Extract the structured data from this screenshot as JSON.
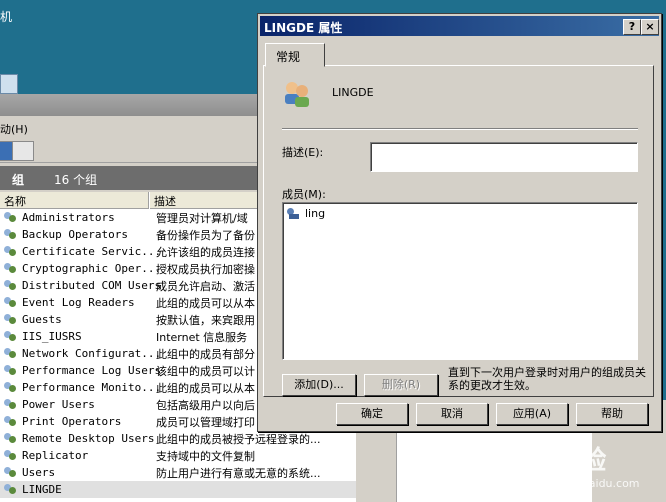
{
  "desktop": {
    "label": "机"
  },
  "bg_window": {
    "menu_label": "动(H)",
    "group_header": {
      "title": "组",
      "count": "16 个组"
    },
    "columns": {
      "name": "名称",
      "desc": "描述"
    },
    "rows": [
      {
        "name": "Administrators",
        "desc": "管理员对计算机/域"
      },
      {
        "name": "Backup Operators",
        "desc": "备份操作员为了备份"
      },
      {
        "name": "Certificate Servic...",
        "desc": "允许该组的成员连接"
      },
      {
        "name": "Cryptographic Oper...",
        "desc": "授权成员执行加密操"
      },
      {
        "name": "Distributed COM Users",
        "desc": "成员允许启动、激活"
      },
      {
        "name": "Event Log Readers",
        "desc": "此组的成员可以从本"
      },
      {
        "name": "Guests",
        "desc": "按默认值，来宾跟用"
      },
      {
        "name": "IIS_IUSRS",
        "desc": "Internet 信息服务"
      },
      {
        "name": "Network Configurat...",
        "desc": "此组中的成员有部分"
      },
      {
        "name": "Performance Log Users",
        "desc": "该组中的成员可以计"
      },
      {
        "name": "Performance Monito...",
        "desc": "此组的成员可以从本"
      },
      {
        "name": "Power Users",
        "desc": "包括高级用户以向后"
      },
      {
        "name": "Print Operators",
        "desc": "成员可以管理域打印"
      },
      {
        "name": "Remote Desktop Users",
        "desc": "此组中的成员被授予远程登录的..."
      },
      {
        "name": "Replicator",
        "desc": "支持域中的文件复制"
      },
      {
        "name": "Users",
        "desc": "防止用户进行有意或无意的系统..."
      },
      {
        "name": "LINGDE",
        "desc": ""
      }
    ]
  },
  "dialog": {
    "title": "LINGDE 属性",
    "help_btn": "?",
    "close_btn": "×",
    "tab_general": "常规",
    "group_name": "LINGDE",
    "desc_label": "描述(E):",
    "desc_value": "",
    "members_label": "成员(M):",
    "members": [
      "ling"
    ],
    "add_button": "添加(D)...",
    "remove_button": "删除(R)",
    "note": "直到下一次用户登录时对用户的组成员关系的更改才生效。",
    "ok_button": "确定",
    "cancel_button": "取消",
    "apply_button": "应用(A)",
    "help_button": "帮助"
  },
  "watermark": {
    "text": "Bai经验",
    "sub": "jingyan.baidu.com"
  }
}
